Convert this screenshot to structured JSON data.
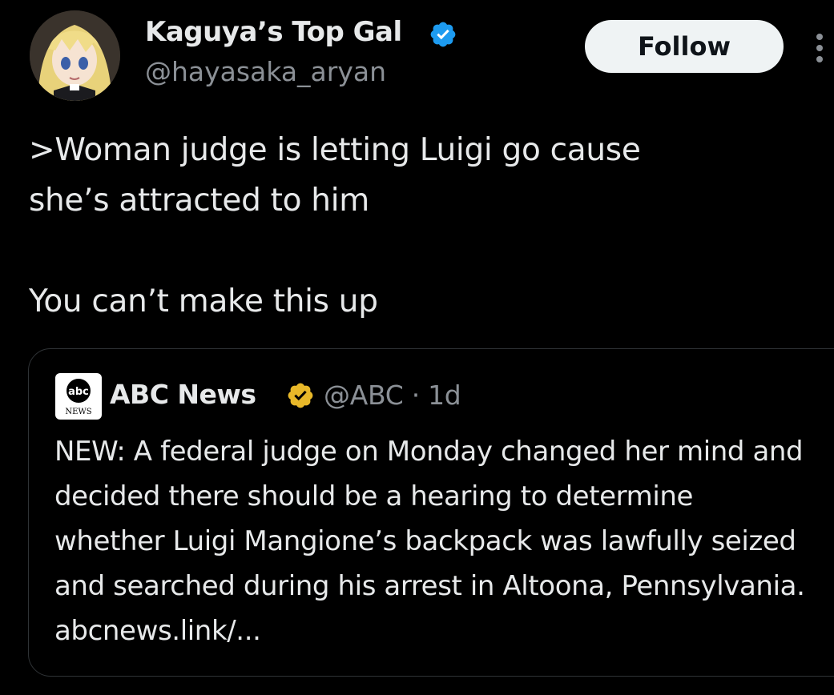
{
  "author": {
    "display_name": "Kaguya’s Top Gal",
    "handle": "@hayasaka_aryan",
    "avatar_icon": "anime-avatar",
    "verified_badge": "verified-blue-badge",
    "badge_color": "#1d9bf0"
  },
  "actions": {
    "follow_label": "Follow",
    "more_icon": "more-options-icon"
  },
  "tweet": {
    "text": ">Woman judge is letting Luigi go cause\nshe’s attracted to him\n\nYou can’t make this up"
  },
  "quote": {
    "avatar_icon": "abc-news-logo",
    "logo_text_top": "abc",
    "logo_text_bottom": "NEWS",
    "display_name": "ABC News",
    "verified_badge": "verified-gold-badge",
    "badge_color": "#e8b829",
    "handle": "@ABC",
    "separator": "·",
    "time": "1d",
    "text": "NEW: A federal judge on Monday changed her mind and decided there should be a hearing to determine whether Luigi Mangione’s backpack was lawfully seized and searched during his arrest in Altoona, Pennsylvania. abcnews.link/..."
  },
  "colors": {
    "background": "#000000",
    "primary_text": "#e7e9ea",
    "secondary_text": "#8b9096",
    "border": "#2f3336",
    "follow_bg": "#eff3f4"
  }
}
